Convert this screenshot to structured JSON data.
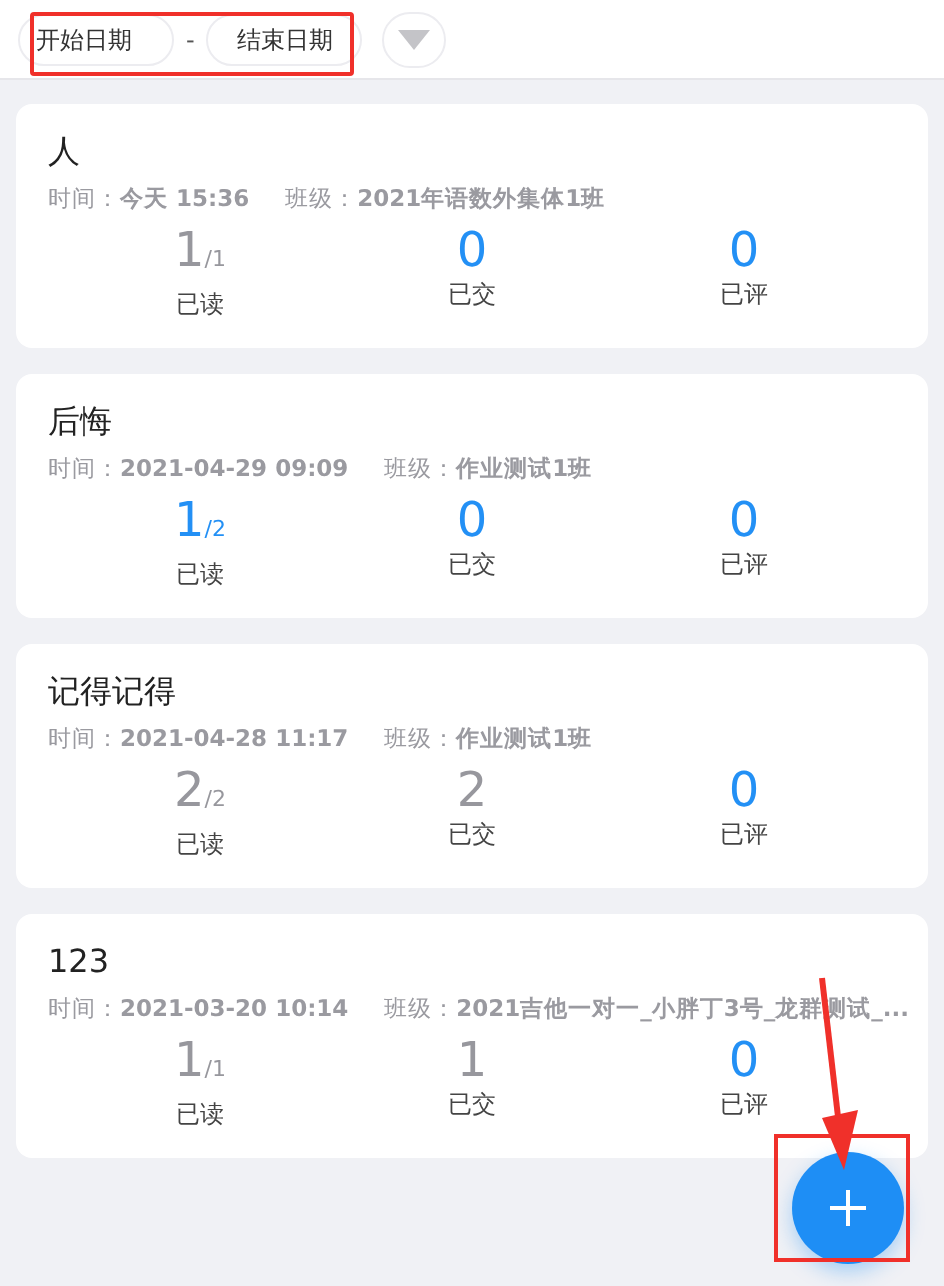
{
  "filter": {
    "start_placeholder": "开始日期",
    "separator": "-",
    "end_placeholder": "结束日期"
  },
  "cards": [
    {
      "title": "人",
      "time_label": "时间：",
      "time": "今天 15:36",
      "class_label": "班级：",
      "class": "2021年语数外集体1班",
      "stats": [
        {
          "value": "1",
          "total": "/1",
          "label": "已读",
          "highlighted": false
        },
        {
          "value": "0",
          "label": "已交",
          "highlighted": true
        },
        {
          "value": "0",
          "label": "已评",
          "highlighted": true
        }
      ]
    },
    {
      "title": "后悔",
      "time_label": "时间：",
      "time": "2021-04-29 09:09",
      "class_label": "班级：",
      "class": "作业测试1班",
      "stats": [
        {
          "value": "1",
          "total": "/2",
          "label": "已读",
          "highlighted": true
        },
        {
          "value": "0",
          "label": "已交",
          "highlighted": true
        },
        {
          "value": "0",
          "label": "已评",
          "highlighted": true
        }
      ]
    },
    {
      "title": "记得记得",
      "time_label": "时间：",
      "time": "2021-04-28 11:17",
      "class_label": "班级：",
      "class": "作业测试1班",
      "stats": [
        {
          "value": "2",
          "total": "/2",
          "label": "已读",
          "highlighted": false
        },
        {
          "value": "2",
          "label": "已交",
          "highlighted": false
        },
        {
          "value": "0",
          "label": "已评",
          "highlighted": true
        }
      ]
    },
    {
      "title": "123",
      "time_label": "时间：",
      "time": "2021-03-20 10:14",
      "class_label": "班级：",
      "class": "2021吉他一对一_小胖丁3号_龙群测试_...",
      "stats": [
        {
          "value": "1",
          "total": "/1",
          "label": "已读",
          "highlighted": false
        },
        {
          "value": "1",
          "label": "已交",
          "highlighted": false
        },
        {
          "value": "0",
          "label": "已评",
          "highlighted": true
        }
      ]
    }
  ]
}
